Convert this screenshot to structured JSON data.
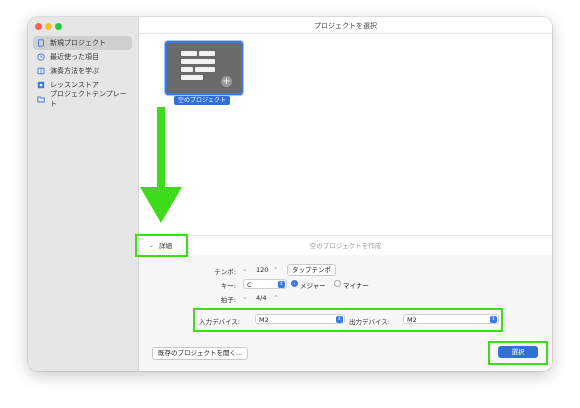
{
  "window": {
    "title": "プロジェクトを選択"
  },
  "sidebar": {
    "items": [
      {
        "label": "新規プロジェクト",
        "icon": "document-icon",
        "selected": true
      },
      {
        "label": "最近使った項目",
        "icon": "clock-icon",
        "selected": false
      },
      {
        "label": "演奏方法を学ぶ",
        "icon": "book-icon",
        "selected": false
      },
      {
        "label": "レッスンストア",
        "icon": "store-icon",
        "selected": false
      },
      {
        "label": "プロジェクトテンプレート",
        "icon": "folder-icon",
        "selected": false
      }
    ]
  },
  "template": {
    "label": "空のプロジェクト"
  },
  "details": {
    "toggle_label": "詳細",
    "caption": "空のプロジェクトを作成"
  },
  "settings": {
    "tempo": {
      "label": "テンポ:",
      "value": "120",
      "tap_button": "タップテンポ"
    },
    "key": {
      "label": "キー:",
      "value": "C",
      "major_label": "メジャー",
      "minor_label": "マイナー",
      "selected": "major"
    },
    "time_signature": {
      "label": "拍子:",
      "value": "4/4"
    },
    "input_device": {
      "label": "入力デバイス:",
      "value": "M2"
    },
    "output_device": {
      "label": "出力デバイス:",
      "value": "M2"
    }
  },
  "footer": {
    "open_existing": "既存のプロジェクトを開く...",
    "choose": "選択"
  },
  "colors": {
    "accent": "#2f6fd8",
    "highlight": "#3ddc1a"
  }
}
